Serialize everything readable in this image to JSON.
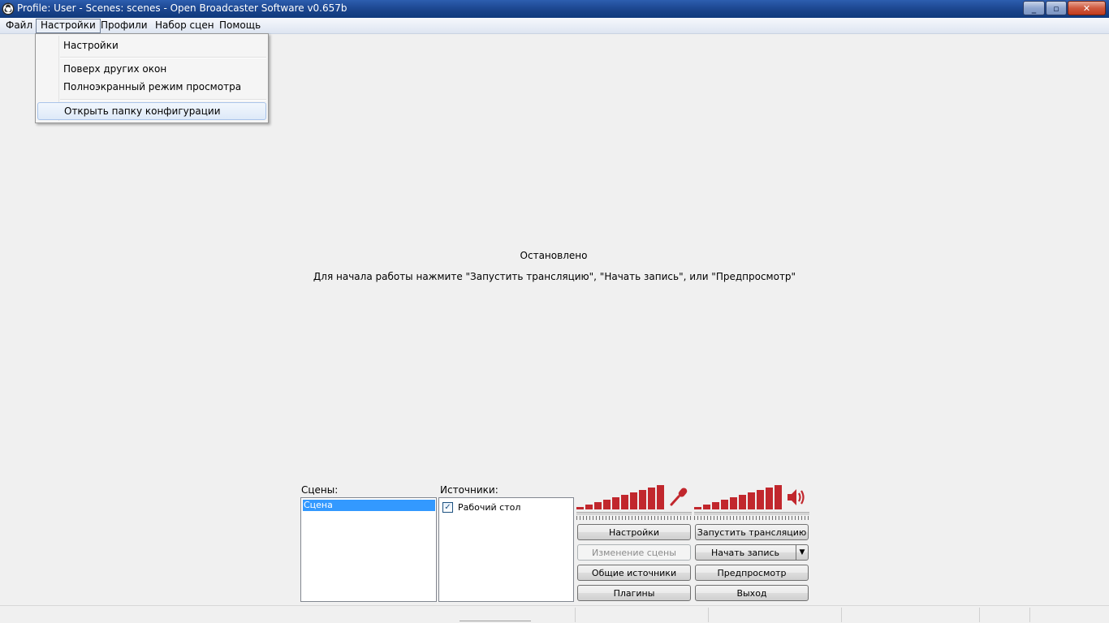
{
  "window": {
    "title": "Profile: User - Scenes: scenes - Open Broadcaster Software v0.657b",
    "minimize_glyph": "_",
    "maximize_glyph": "▫",
    "close_glyph": "✕"
  },
  "menu": {
    "file": "Файл",
    "settings": "Настройки",
    "profiles": "Профили",
    "scene_collection": "Набор сцен",
    "help": "Помощь"
  },
  "dropdown": {
    "items": [
      {
        "label": "Настройки"
      },
      {
        "label": "Поверх других окон"
      },
      {
        "label": "Полноэкранный режим просмотра"
      },
      {
        "label": "Открыть папку конфигурации",
        "highlighted": true
      }
    ]
  },
  "preview": {
    "status": "Остановлено",
    "hint": "Для начала работы нажмите \"Запустить трансляцию\", \"Начать запись\", или \"Предпросмотр\""
  },
  "scenes": {
    "label": "Сцены:",
    "items": [
      "Сцена"
    ]
  },
  "sources": {
    "label": "Источники:",
    "items": [
      {
        "label": "Рабочий стол",
        "checked": true
      }
    ]
  },
  "audio": {
    "mic_icon": "microphone-icon",
    "speaker_icon": "speaker-icon",
    "bar_color": "#c1272d",
    "mic_level": 1.0,
    "desktop_level": 1.0
  },
  "buttons": {
    "settings": "Настройки",
    "scene_edit": "Изменение сцены",
    "global_sources": "Общие источники",
    "plugins": "Плагины",
    "start_stream": "Запустить трансляцию",
    "start_record": "Начать запись",
    "preview": "Предпросмотр",
    "exit": "Выход"
  },
  "colors": {
    "titlebar": "#19428a",
    "selection": "#3399ff",
    "meter": "#c1272d"
  }
}
